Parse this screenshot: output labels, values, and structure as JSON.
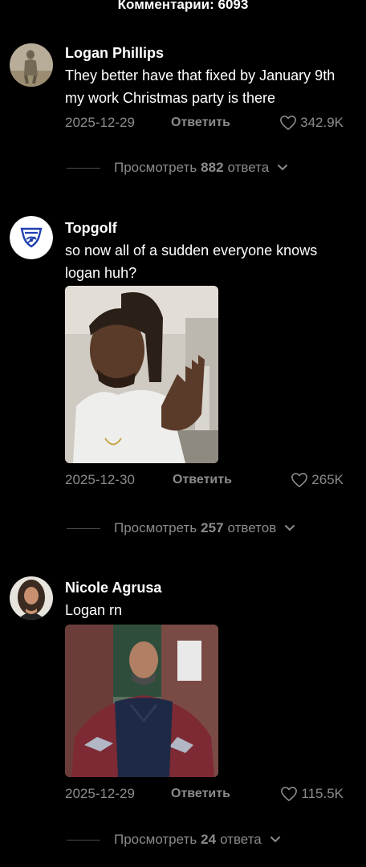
{
  "header": {
    "title": "Комментарии: 6093"
  },
  "comments": [
    {
      "username": "Logan Phillips",
      "text": "They better have that fixed by January 9th my work Christmas party is there",
      "date": "2025-12-29",
      "reply_label": "Ответить",
      "likes": "342.9K",
      "view_replies": {
        "prefix": "Просмотреть",
        "count": "882",
        "suffix": "ответа"
      }
    },
    {
      "username": "Topgolf",
      "text": "so now all of a sudden everyone knows logan huh?",
      "date": "2025-12-30",
      "reply_label": "Ответить",
      "likes": "265K",
      "view_replies": {
        "prefix": "Просмотреть",
        "count": "257",
        "suffix": "ответов"
      }
    },
    {
      "username": "Nicole Agrusa",
      "text": "Logan rn",
      "date": "2025-12-29",
      "reply_label": "Ответить",
      "likes": "115.5K",
      "view_replies": {
        "prefix": "Просмотреть",
        "count": "24",
        "suffix": "ответа"
      }
    }
  ],
  "colors": {
    "background": "#000000",
    "text": "#ffffff",
    "muted": "#8b8b8b",
    "divider": "#4a4a4a",
    "topgolf_blue": "#1f3fb0"
  },
  "icons": {
    "like": "heart-outline-icon",
    "expand": "chevron-down-icon"
  }
}
